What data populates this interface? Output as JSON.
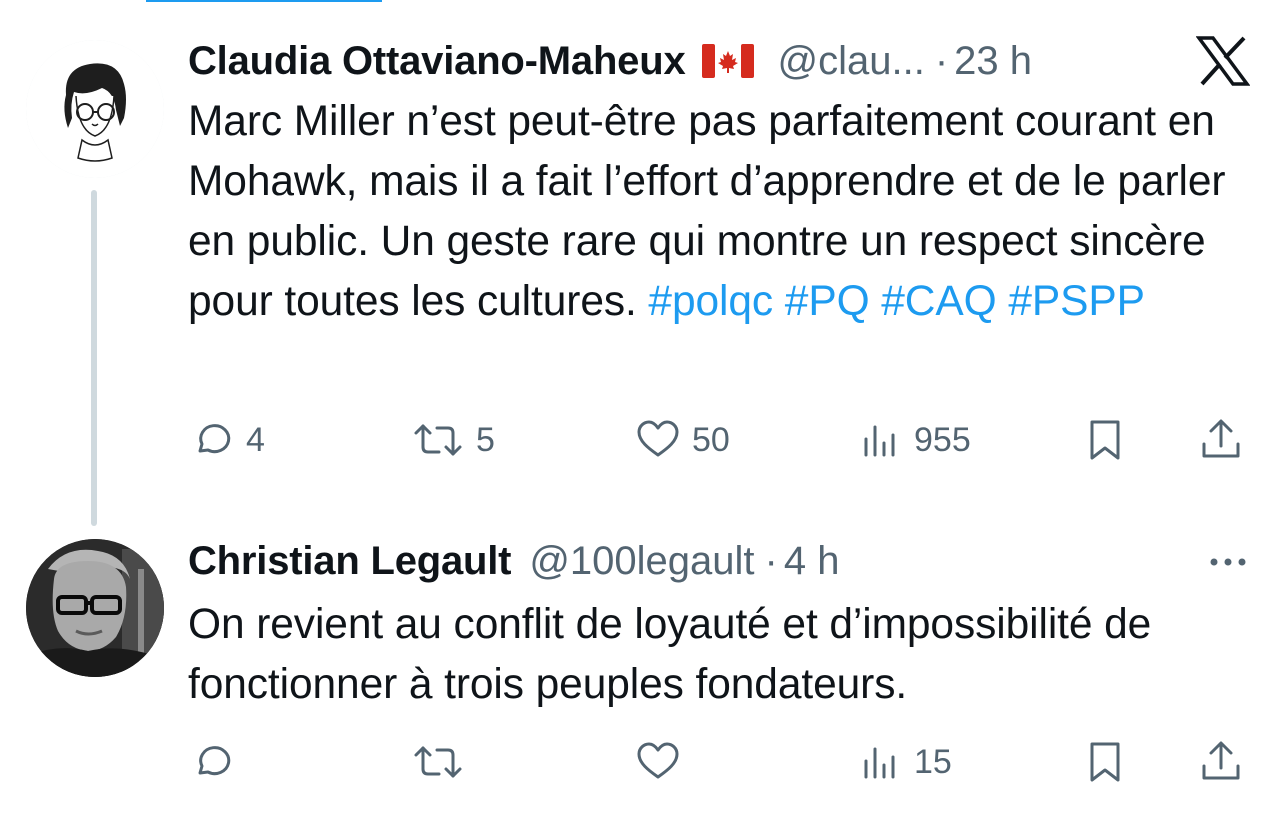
{
  "tweets": [
    {
      "author": {
        "display_name": "Claudia Ottaviano-Maheux",
        "flag": "canada-flag",
        "handle": "@clau...",
        "separator": "·",
        "time": "23 h"
      },
      "text_parts": [
        "Marc Miller n’est peut-être pas parfaitement courant  en Mohawk, mais il a fait l’effort d’apprendre et de le parler en public. Un geste rare qui montre un respect sincère pour toutes les cultures. "
      ],
      "hashtags": [
        "#polqc",
        "#PQ",
        "#CAQ",
        "#PSPP"
      ],
      "actions": {
        "replies": "4",
        "retweets": "5",
        "likes": "50",
        "views": "955"
      }
    },
    {
      "author": {
        "display_name": "Christian Legault",
        "handle": "@100legault",
        "separator": "·",
        "time": "4 h"
      },
      "text": "On revient au conflit de loyauté et d’impossibilité de fonctionner à trois peuples fondateurs.",
      "actions": {
        "replies": "",
        "retweets": "",
        "likes": "",
        "views": "15"
      }
    }
  ],
  "icons": {
    "brand": "x-logo",
    "more": "more-options-icon"
  },
  "colors": {
    "text": "#0f1419",
    "secondary": "#536471",
    "link": "#1d9bf0",
    "thread_line": "#cfd9de"
  }
}
